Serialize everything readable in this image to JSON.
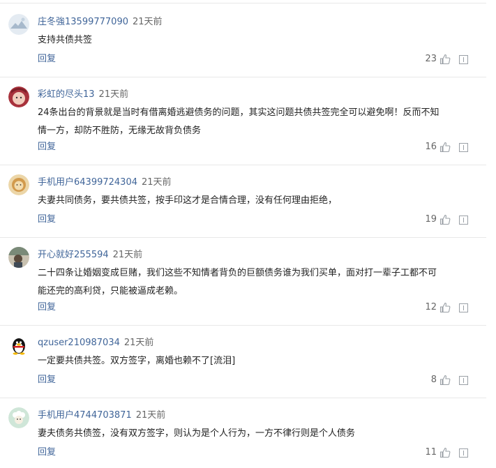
{
  "comments": [
    {
      "username": "庄冬強13599777090",
      "time": "21天前",
      "lines": [
        "支持共债共签"
      ],
      "reply_label": "回复",
      "likes": "23",
      "avatar": "landscape-avatar",
      "avatar_colors": [
        "#dfe7f0",
        "#93a9c2"
      ]
    },
    {
      "username": "彩虹的尽头13",
      "time": "21天前",
      "lines": [
        "24条出台的背景就是当时有借离婚逃避债务的问题，其实这问题共债共签完全可以避免啊！反而不知",
        "情一方，却防不胜防，无缘无故背负债务"
      ],
      "reply_label": "回复",
      "likes": "16",
      "avatar": "baby-photo-avatar",
      "avatar_colors": [
        "#b9474f",
        "#f1c6b6"
      ]
    },
    {
      "username": "手机用户64399724304",
      "time": "21天前",
      "lines": [
        "夫妻共同债务，要共债共签，按手印这才是合情合理，没有任何理由拒绝，"
      ],
      "reply_label": "回复",
      "likes": "19",
      "avatar": "lion-avatar",
      "avatar_colors": [
        "#e9d2a4",
        "#c48a3c"
      ]
    },
    {
      "username": "开心就好255594",
      "time": "21天前",
      "lines": [
        "二十四条让婚姻变成巨赌，我们这些不知情者背负的巨额债务谁为我们买单，面对打一辈子工都不可",
        "能还完的高利贷，只能被逼成老赖。"
      ],
      "reply_label": "回复",
      "likes": "12",
      "avatar": "photo-avatar",
      "avatar_colors": [
        "#6b7a6a",
        "#c9c2b2"
      ]
    },
    {
      "username": "qzuser210987034",
      "time": "21天前",
      "lines": [
        "一定要共债共签。双方签字，离婚也赖不了[流泪]"
      ],
      "reply_label": "回复",
      "likes": "8",
      "avatar": "penguin-avatar",
      "avatar_colors": [
        "#1a1a1a",
        "#f5c000"
      ]
    },
    {
      "username": "手机用户4744703871",
      "time": "21天前",
      "lines": [
        "妻夫债务共债签，没有双方签字，则认为是个人行为，一方不律行则是个人债务"
      ],
      "reply_label": "回复",
      "likes": "11",
      "avatar": "sheep-avatar",
      "avatar_colors": [
        "#cfe3d6",
        "#7ea88d"
      ]
    }
  ],
  "icons": {
    "like": "thumbs-up-icon",
    "report": "report-icon"
  },
  "colors": {
    "username": "#406599",
    "reply": "#406599",
    "text": "#222222",
    "muted": "#666666"
  }
}
